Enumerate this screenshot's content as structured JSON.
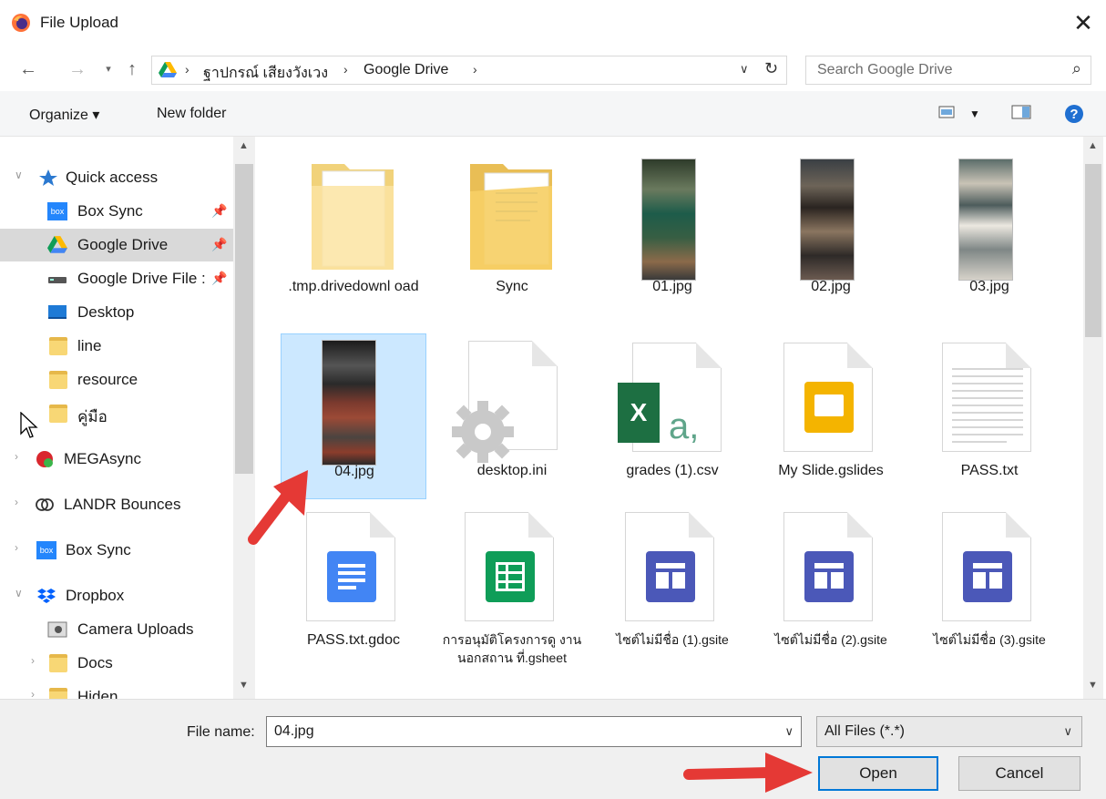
{
  "window": {
    "title": "File Upload",
    "close_glyph": "✕"
  },
  "nav": {
    "breadcrumb": [
      "ฐาปกรณ์ เสียงวังเวง",
      "Google Drive"
    ],
    "search_placeholder": "Search Google Drive"
  },
  "toolbar": {
    "organize": "Organize ▾",
    "new_folder": "New folder"
  },
  "sidebar": {
    "items": [
      {
        "label": "Quick access",
        "icon": "star-icon"
      },
      {
        "label": "Box Sync",
        "icon": "box-icon",
        "pinned": true
      },
      {
        "label": "Google Drive",
        "icon": "google-drive-icon",
        "pinned": true,
        "selected": true
      },
      {
        "label": "Google Drive File :",
        "icon": "drive-icon",
        "pinned": true
      },
      {
        "label": "Desktop",
        "icon": "desktop-icon"
      },
      {
        "label": "line",
        "icon": "folder-icon"
      },
      {
        "label": "resource",
        "icon": "folder-icon"
      },
      {
        "label": "คู่มือ",
        "icon": "folder-icon"
      },
      {
        "label": "MEGAsync",
        "icon": "mega-icon"
      },
      {
        "label": "LANDR Bounces",
        "icon": "landr-icon"
      },
      {
        "label": "Box Sync",
        "icon": "box-icon"
      },
      {
        "label": "Dropbox",
        "icon": "dropbox-icon"
      },
      {
        "label": "Camera Uploads",
        "icon": "camera-folder-icon"
      },
      {
        "label": "Docs",
        "icon": "folder-icon"
      },
      {
        "label": "Hiden",
        "icon": "folder-icon"
      }
    ]
  },
  "files": [
    {
      "name": ".tmp.drivedownl oad",
      "kind": "folder-empty"
    },
    {
      "name": "Sync",
      "kind": "folder"
    },
    {
      "name": "01.jpg",
      "kind": "photo"
    },
    {
      "name": "02.jpg",
      "kind": "photo"
    },
    {
      "name": "03.jpg",
      "kind": "photo"
    },
    {
      "name": "04.jpg",
      "kind": "photo",
      "selected": true
    },
    {
      "name": "desktop.ini",
      "kind": "ini"
    },
    {
      "name": "grades (1).csv",
      "kind": "excel"
    },
    {
      "name": "My Slide.gslides",
      "kind": "gslides"
    },
    {
      "name": "PASS.txt",
      "kind": "txt"
    },
    {
      "name": "PASS.txt.gdoc",
      "kind": "gdoc"
    },
    {
      "name": "การอนุมัติโครงการดู งานนอกสถาน ที่.gsheet",
      "kind": "gsheet"
    },
    {
      "name": "ไซต์ไม่มีชื่อ (1).gsite",
      "kind": "gsite"
    },
    {
      "name": "ไซต์ไม่มีชื่อ (2).gsite",
      "kind": "gsite"
    },
    {
      "name": "ไซต์ไม่มีชื่อ (3).gsite",
      "kind": "gsite"
    }
  ],
  "bottom": {
    "file_name_label": "File name:",
    "file_name_value": "04.jpg",
    "file_type": "All Files (*.*)",
    "open": "Open",
    "cancel": "Cancel"
  },
  "colors": {
    "accent": "#0078d7",
    "selection": "#cce8ff",
    "annotation_arrow": "#e53935"
  }
}
